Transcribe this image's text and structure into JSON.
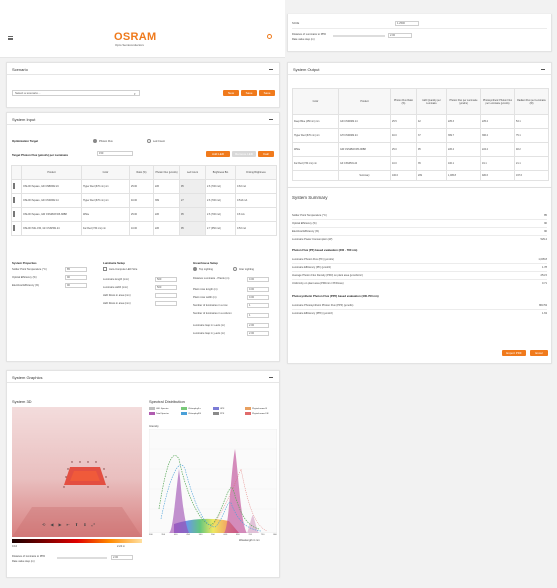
{
  "header": {
    "brand": "OSRAM",
    "tagline": "Opto Semiconductors",
    "menu_icon": "hamburger-icon",
    "search_icon": "search-icon"
  },
  "top_right": {
    "label1": "SCCE",
    "value1": "1.2500",
    "label2": "Distance of Luminaire to PPD",
    "label3": "Rate value step (m)",
    "value2": "2.00"
  },
  "scenario": {
    "title": "Scenario",
    "placeholder": "Select a scenario...",
    "buttons": [
      "New",
      "Save",
      "Save"
    ]
  },
  "system_input": {
    "title": "System Input",
    "optimization_label": "Optimization Target",
    "radio1": "Photon Flux",
    "radio2": "Led Count",
    "target_label": "Target Photon Flux (µmol/s) per Luminaire",
    "target_value": "150",
    "add_led": "Add LED",
    "remove_led": "Remove LED",
    "calc": "Calc",
    "columns": [
      "",
      "Product",
      "Color",
      "Ratio (%)",
      "Photon Flux (µmol/s)",
      "Led Count",
      "Brightness Bin",
      "Driving Brightness"
    ],
    "rows": [
      {
        "product": "OSLON Square, GD CSBRM2.24",
        "color": "Hyper Red (670 nm) nm",
        "ratio": "25.00",
        "flux": "226",
        "count": "95",
        "bin": "2.6 (700 mA)",
        "drive": "0.63",
        "unit": "mA"
      },
      {
        "product": "OSLON Square, GD CSSRM2.14",
        "color": "Hyper Red (670 nm) nm",
        "ratio": "40.00",
        "flux": "369",
        "count": "27",
        "bin": "2.6 (700 mA)",
        "drive": "0.513",
        "unit": "mA"
      },
      {
        "product": "OSLON Square, GW CSSRM3.W5-N6B8",
        "color": "White",
        "ratio": "25.00",
        "flux": "226",
        "count": "95",
        "bin": "2.6 (700 mA)",
        "drive": "0.8",
        "unit": "mA"
      },
      {
        "product": "OSLON SSL 150, GF CSSPM1.24",
        "color": "Far Red (730 nm) nm",
        "ratio": "10.00",
        "flux": "226",
        "count": "95",
        "bin": "2.7 (350 mA)",
        "drive": "0.53",
        "unit": "mA"
      }
    ]
  },
  "system_properties": {
    "title": "System Properties",
    "fields": [
      {
        "label": "Solder Point Temperature (°C)",
        "value": "85"
      },
      {
        "label": "Optical Efficiency (%)",
        "value": "90"
      },
      {
        "label": "Electrical Efficiency (%)",
        "value": "90"
      }
    ]
  },
  "luminaire_setup": {
    "title": "Luminaire Setup",
    "checkbox": "Auto-Compute LED Size",
    "fields": [
      {
        "label": "Luminaire length (mm)",
        "value": "500"
      },
      {
        "label": "Luminaire width (mm)",
        "value": "500"
      },
      {
        "label": "LED Rows in area (mm)",
        "value": ""
      },
      {
        "label": "LED Rows in area (mm)",
        "value": ""
      }
    ]
  },
  "greenhouse_setup": {
    "title": "Greenhouse Setup",
    "radio1": "Top Lighting",
    "radio2": "Inter Lighting",
    "fields": [
      {
        "label": "Distance Luminaire - Plants (m)",
        "value": "0.00"
      },
      {
        "label": "Plant rows length (m)",
        "value": "0.00"
      },
      {
        "label": "Plant rows width (m)",
        "value": "0.00"
      },
      {
        "label": "Number of luminaires in a row",
        "value": "1"
      },
      {
        "label": "Number of luminaires in a column",
        "value": "1"
      },
      {
        "label": "Luminaire Gap in x-axis (m)",
        "value": "2.00"
      },
      {
        "label": "Luminaire Gap in y-axis (m)",
        "value": "2.00"
      }
    ]
  },
  "system_output": {
    "title": "System Output",
    "columns": [
      "Color",
      "Product",
      "Photon Flux Ratio (%)",
      "LED Quantity per Luminaire",
      "Photon Flux per Luminaire (µmol/s)",
      "Photosynthetic Photon Flux per Luminaire (µmol/s)",
      "Radiant Flux per Luminaire (W)"
    ],
    "rows": [
      {
        "color": "Deep Blue (450 nm) nm",
        "product": "GD CSSRM2.14",
        "ratio": "25.5",
        "qty": "42",
        "flux": "225.3",
        "ppf": "225.2",
        "rad": "53.1"
      },
      {
        "color": "Hyper Red (670 nm) nm",
        "product": "GH CSSRM2.24",
        "ratio": "40.0",
        "qty": "37",
        "flux": "369.7",
        "ppf": "366.2",
        "rad": "75.1"
      },
      {
        "color": "White",
        "product": "GW CSSRM3.W5-N6B8",
        "ratio": "25.0",
        "qty": "95",
        "flux": "226.4",
        "ppf": "224.2",
        "rad": "48.2"
      },
      {
        "color": "Far Red (730 nm) nm",
        "product": "GF CSSPM1.24",
        "ratio": "10.0",
        "qty": "35",
        "flux": "100.1",
        "ppf": "19.1",
        "rad": "21.1"
      }
    ],
    "summary_row": {
      "label": "Summary",
      "ratio": "100.0",
      "qty": "209",
      "flux": "1,005.8",
      "ppf": "920.6",
      "rad": "197.6"
    }
  },
  "system_summary": {
    "title": "System Summary",
    "rows1": [
      {
        "label": "Solder Point Temperature (°C)",
        "value": "85"
      },
      {
        "label": "Optical Efficiency (%)",
        "value": "90"
      },
      {
        "label": "Electrical Efficiency (%)",
        "value": "90"
      },
      {
        "label": "Luminaire Power Consumption (W)",
        "value": "529.4"
      }
    ],
    "section2": "Photon Flux (PF) based evaluation (300 - 780 nm)",
    "rows2": [
      {
        "label": "Luminaire Photon Flux (PF) (µmol/s)",
        "value": "1,005.8"
      },
      {
        "label": "Luminaire Efficiency (PF) (µmol/J)",
        "value": "1.78"
      },
      {
        "label": "Average Photon Flux Density (PFD) on plant area (µmol/s/m²)",
        "value": "251.5"
      },
      {
        "label": "Uniformity on plant area (PFDmin / PFDmax)",
        "value": "0.71"
      }
    ],
    "section3": "Photosynthetic Photon Flux (PPF) based evaluation (400-700 nm)",
    "rows3": [
      {
        "label": "Luminaire Photosynthetic Photon Flux (PPF) (µmol/s)",
        "value": "863.53"
      },
      {
        "label": "Luminaire Efficiency (PPF) (µmol/J)",
        "value": "1.63"
      }
    ],
    "buttons": [
      "Export PDF",
      "Excel"
    ]
  },
  "system_graphics": {
    "title": "System Graphics",
    "view3d_title": "System 3D",
    "scale_min": "0.10",
    "scale_max": "2.24 m",
    "bottom_label1": "Distance of luminaire to PPD",
    "bottom_label2": "Rate value step (m)",
    "bottom_value": "2.00",
    "spectral_title": "Spectral Distribution",
    "legend": [
      {
        "label": "LED Spectra",
        "color": "#bfbfbf"
      },
      {
        "label": "Chlorophyll a",
        "color": "#78c878"
      },
      {
        "label": "UPF",
        "color": "#7b7bd6"
      },
      {
        "label": "Phytochrome R",
        "color": "#e8a060"
      },
      {
        "label": "Total Spectra",
        "color": "#b05cb0"
      },
      {
        "label": "Chlorophyll B",
        "color": "#4aa0d8"
      },
      {
        "label": "PPF",
        "color": "#8a8a8a"
      },
      {
        "label": "Phytochrome FR",
        "color": "#e06b6b"
      }
    ],
    "y_label": "Intensity",
    "x_label": "Wavelength in nm",
    "x_ticks": [
      "300",
      "350",
      "400",
      "450",
      "500",
      "550",
      "600",
      "650",
      "700",
      "750",
      "800"
    ]
  }
}
